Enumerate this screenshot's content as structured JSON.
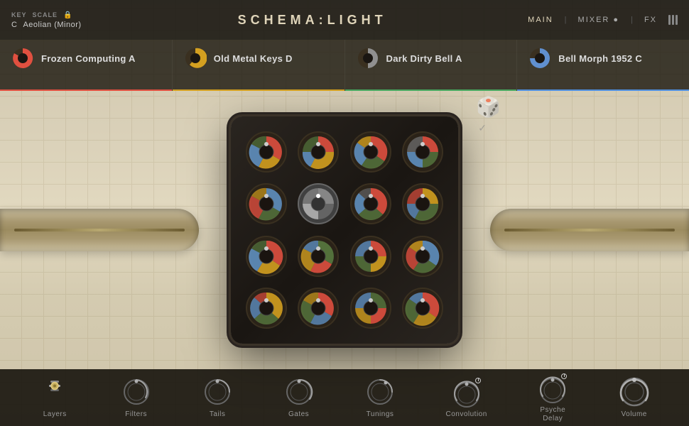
{
  "app": {
    "title_prefix": "SCHEMA:",
    "title_suffix": "LIGHT"
  },
  "header": {
    "key_label": "KEY",
    "key_value": "C",
    "scale_label": "SCALE",
    "scale_value": "Aeolian (Minor)",
    "nav": {
      "main": "MAIN",
      "mixer": "MIXER ●",
      "fx": "FX"
    }
  },
  "instruments": [
    {
      "name": "Frozen Computing A",
      "color": "#e05040",
      "underline": "#e05040",
      "pie_fill": 0.7
    },
    {
      "name": "Old Metal Keys D",
      "color": "#d4a020",
      "underline": "#d4a020",
      "pie_fill": 0.6
    },
    {
      "name": "Dark Dirty Bell A",
      "color": "#909090",
      "underline": "#48a860",
      "pie_fill": 0.5
    },
    {
      "name": "Bell Morph 1952 C",
      "color": "#6090d0",
      "underline": "#5090e0",
      "pie_fill": 0.75
    }
  ],
  "bottom_controls": [
    {
      "id": "layers",
      "label": "Layers",
      "type": "layers"
    },
    {
      "id": "filters",
      "label": "Filters",
      "type": "knob"
    },
    {
      "id": "tails",
      "label": "Tails",
      "type": "knob"
    },
    {
      "id": "gates",
      "label": "Gates",
      "type": "knob"
    },
    {
      "id": "tunings",
      "label": "Tunings",
      "type": "knob"
    },
    {
      "id": "convolution",
      "label": "Convolution",
      "type": "knob_power"
    },
    {
      "id": "psyche-delay",
      "label": "Psyche\nDelay",
      "type": "knob_power"
    },
    {
      "id": "volume",
      "label": "Volume",
      "type": "knob_large"
    }
  ],
  "colors": {
    "accent_red": "#e05040",
    "accent_yellow": "#d4a020",
    "accent_green": "#48a860",
    "accent_blue": "#5090e0",
    "bg_header": "#1a1710",
    "bg_bottom": "#161310"
  }
}
